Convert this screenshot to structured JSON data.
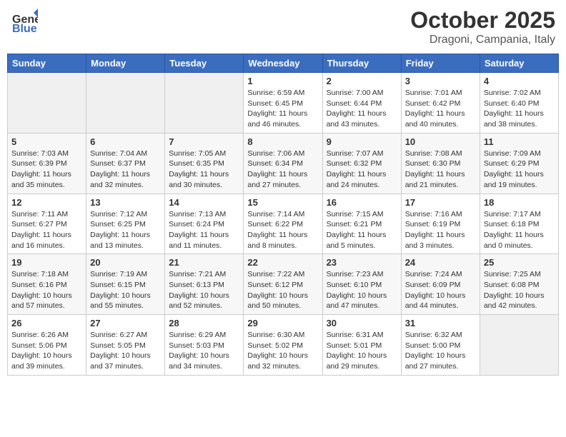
{
  "header": {
    "logo_general": "General",
    "logo_blue": "Blue",
    "month": "October 2025",
    "location": "Dragoni, Campania, Italy"
  },
  "weekdays": [
    "Sunday",
    "Monday",
    "Tuesday",
    "Wednesday",
    "Thursday",
    "Friday",
    "Saturday"
  ],
  "weeks": [
    [
      {
        "day": "",
        "info": ""
      },
      {
        "day": "",
        "info": ""
      },
      {
        "day": "",
        "info": ""
      },
      {
        "day": "1",
        "info": "Sunrise: 6:59 AM\nSunset: 6:45 PM\nDaylight: 11 hours\nand 46 minutes."
      },
      {
        "day": "2",
        "info": "Sunrise: 7:00 AM\nSunset: 6:44 PM\nDaylight: 11 hours\nand 43 minutes."
      },
      {
        "day": "3",
        "info": "Sunrise: 7:01 AM\nSunset: 6:42 PM\nDaylight: 11 hours\nand 40 minutes."
      },
      {
        "day": "4",
        "info": "Sunrise: 7:02 AM\nSunset: 6:40 PM\nDaylight: 11 hours\nand 38 minutes."
      }
    ],
    [
      {
        "day": "5",
        "info": "Sunrise: 7:03 AM\nSunset: 6:39 PM\nDaylight: 11 hours\nand 35 minutes."
      },
      {
        "day": "6",
        "info": "Sunrise: 7:04 AM\nSunset: 6:37 PM\nDaylight: 11 hours\nand 32 minutes."
      },
      {
        "day": "7",
        "info": "Sunrise: 7:05 AM\nSunset: 6:35 PM\nDaylight: 11 hours\nand 30 minutes."
      },
      {
        "day": "8",
        "info": "Sunrise: 7:06 AM\nSunset: 6:34 PM\nDaylight: 11 hours\nand 27 minutes."
      },
      {
        "day": "9",
        "info": "Sunrise: 7:07 AM\nSunset: 6:32 PM\nDaylight: 11 hours\nand 24 minutes."
      },
      {
        "day": "10",
        "info": "Sunrise: 7:08 AM\nSunset: 6:30 PM\nDaylight: 11 hours\nand 21 minutes."
      },
      {
        "day": "11",
        "info": "Sunrise: 7:09 AM\nSunset: 6:29 PM\nDaylight: 11 hours\nand 19 minutes."
      }
    ],
    [
      {
        "day": "12",
        "info": "Sunrise: 7:11 AM\nSunset: 6:27 PM\nDaylight: 11 hours\nand 16 minutes."
      },
      {
        "day": "13",
        "info": "Sunrise: 7:12 AM\nSunset: 6:25 PM\nDaylight: 11 hours\nand 13 minutes."
      },
      {
        "day": "14",
        "info": "Sunrise: 7:13 AM\nSunset: 6:24 PM\nDaylight: 11 hours\nand 11 minutes."
      },
      {
        "day": "15",
        "info": "Sunrise: 7:14 AM\nSunset: 6:22 PM\nDaylight: 11 hours\nand 8 minutes."
      },
      {
        "day": "16",
        "info": "Sunrise: 7:15 AM\nSunset: 6:21 PM\nDaylight: 11 hours\nand 5 minutes."
      },
      {
        "day": "17",
        "info": "Sunrise: 7:16 AM\nSunset: 6:19 PM\nDaylight: 11 hours\nand 3 minutes."
      },
      {
        "day": "18",
        "info": "Sunrise: 7:17 AM\nSunset: 6:18 PM\nDaylight: 11 hours\nand 0 minutes."
      }
    ],
    [
      {
        "day": "19",
        "info": "Sunrise: 7:18 AM\nSunset: 6:16 PM\nDaylight: 10 hours\nand 57 minutes."
      },
      {
        "day": "20",
        "info": "Sunrise: 7:19 AM\nSunset: 6:15 PM\nDaylight: 10 hours\nand 55 minutes."
      },
      {
        "day": "21",
        "info": "Sunrise: 7:21 AM\nSunset: 6:13 PM\nDaylight: 10 hours\nand 52 minutes."
      },
      {
        "day": "22",
        "info": "Sunrise: 7:22 AM\nSunset: 6:12 PM\nDaylight: 10 hours\nand 50 minutes."
      },
      {
        "day": "23",
        "info": "Sunrise: 7:23 AM\nSunset: 6:10 PM\nDaylight: 10 hours\nand 47 minutes."
      },
      {
        "day": "24",
        "info": "Sunrise: 7:24 AM\nSunset: 6:09 PM\nDaylight: 10 hours\nand 44 minutes."
      },
      {
        "day": "25",
        "info": "Sunrise: 7:25 AM\nSunset: 6:08 PM\nDaylight: 10 hours\nand 42 minutes."
      }
    ],
    [
      {
        "day": "26",
        "info": "Sunrise: 6:26 AM\nSunset: 5:06 PM\nDaylight: 10 hours\nand 39 minutes."
      },
      {
        "day": "27",
        "info": "Sunrise: 6:27 AM\nSunset: 5:05 PM\nDaylight: 10 hours\nand 37 minutes."
      },
      {
        "day": "28",
        "info": "Sunrise: 6:29 AM\nSunset: 5:03 PM\nDaylight: 10 hours\nand 34 minutes."
      },
      {
        "day": "29",
        "info": "Sunrise: 6:30 AM\nSunset: 5:02 PM\nDaylight: 10 hours\nand 32 minutes."
      },
      {
        "day": "30",
        "info": "Sunrise: 6:31 AM\nSunset: 5:01 PM\nDaylight: 10 hours\nand 29 minutes."
      },
      {
        "day": "31",
        "info": "Sunrise: 6:32 AM\nSunset: 5:00 PM\nDaylight: 10 hours\nand 27 minutes."
      },
      {
        "day": "",
        "info": ""
      }
    ]
  ]
}
